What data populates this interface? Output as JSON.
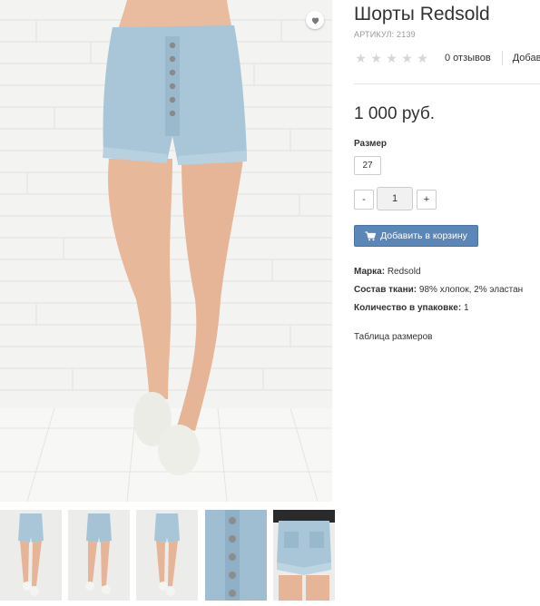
{
  "product": {
    "title": "Шорты Redsold",
    "sku": "АРТИКУЛ: 2139",
    "reviews": "0 отзывов",
    "add_review": "Добавить отзыв",
    "rating_stars": 0,
    "price": "1 000 руб.",
    "size_label": "Размер",
    "size_option": "27",
    "qty_minus": "-",
    "qty_value": "1",
    "qty_plus": "+",
    "cart_button": "Добавить в корзину",
    "brand_label": "Марка:",
    "brand_value": "Redsold",
    "composition_label": "Состав ткани:",
    "composition_value": "98% хлопок, 2% эластан",
    "pack_label": "Количество в упаковке:",
    "pack_value": "1",
    "size_table_link": "Таблица размеров"
  },
  "icons": {
    "wishlist": "heart-icon",
    "cart": "shopping-cart-icon",
    "star": "star-icon"
  },
  "colors": {
    "accent": "#5b87b8",
    "star_empty": "#d6d6d6",
    "denim": "#a9c6d8"
  }
}
